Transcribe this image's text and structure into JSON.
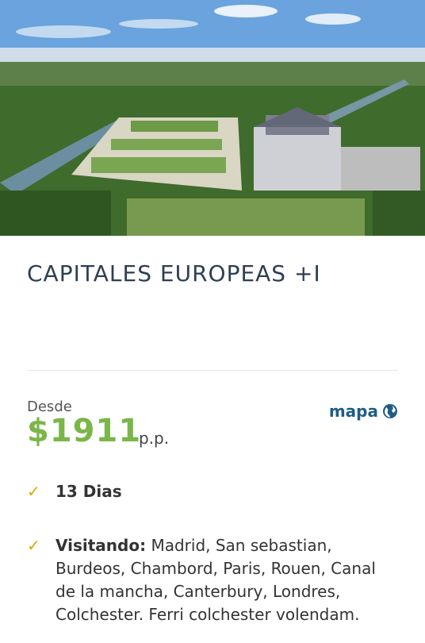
{
  "tour": {
    "title": "CAPITALES EUROPEAS +I",
    "price_prefix": "Desde",
    "price": "$1911",
    "price_suffix": "p.p.",
    "map_link": "mapa",
    "duration": "13 Dias",
    "visiting_label": "Visitando:",
    "visiting_text": "Madrid, San sebastian, Burdeos, Chambord, Paris, Rouen, Canal de la mancha, Canterbury, Londres, Colchester. Ferri colchester volendam."
  },
  "colors": {
    "title": "#2e3f52",
    "price": "#7ab648",
    "link": "#1f5c88",
    "check": "#e0a800"
  },
  "icons": {
    "map": "globe-icon",
    "check": "checkmark-icon"
  }
}
